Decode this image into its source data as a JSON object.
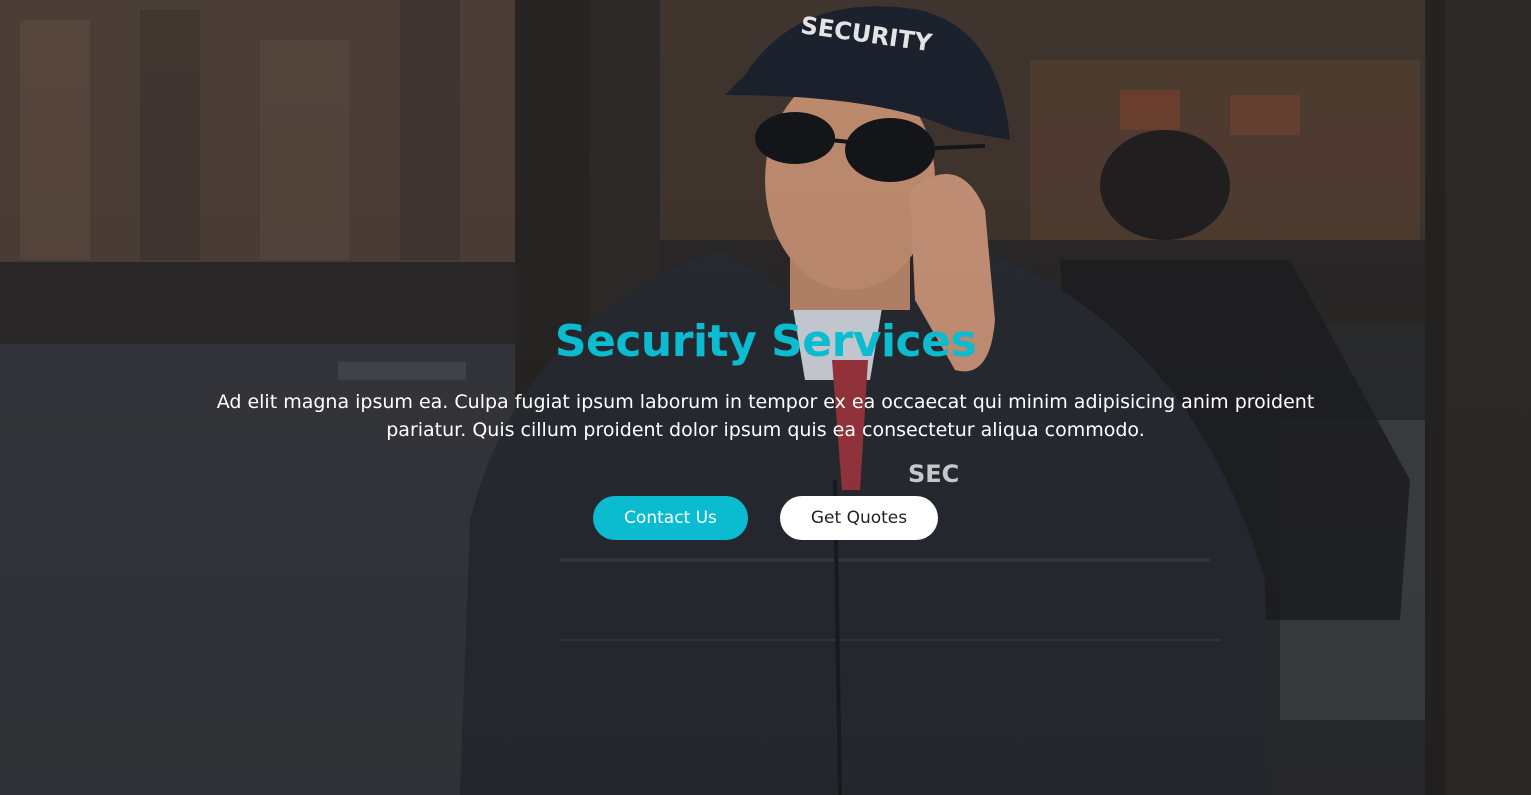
{
  "hero": {
    "title": "Security Services",
    "description": "Ad elit magna ipsum ea. Culpa fugiat ipsum laborum in tempor ex ea occaecat qui minim adipisicing anim proident pariatur. Quis cillum proident dolor ipsum quis ea consectetur aliqua commodo.",
    "cap_text": "SECURITY",
    "jacket_text": "SEC",
    "buttons": {
      "primary_label": "Contact Us",
      "secondary_label": "Get Quotes"
    }
  },
  "colors": {
    "accent": "#0bbcd0",
    "text_light": "#ffffff",
    "button_secondary_bg": "#ffffff",
    "button_secondary_text": "#222222"
  }
}
